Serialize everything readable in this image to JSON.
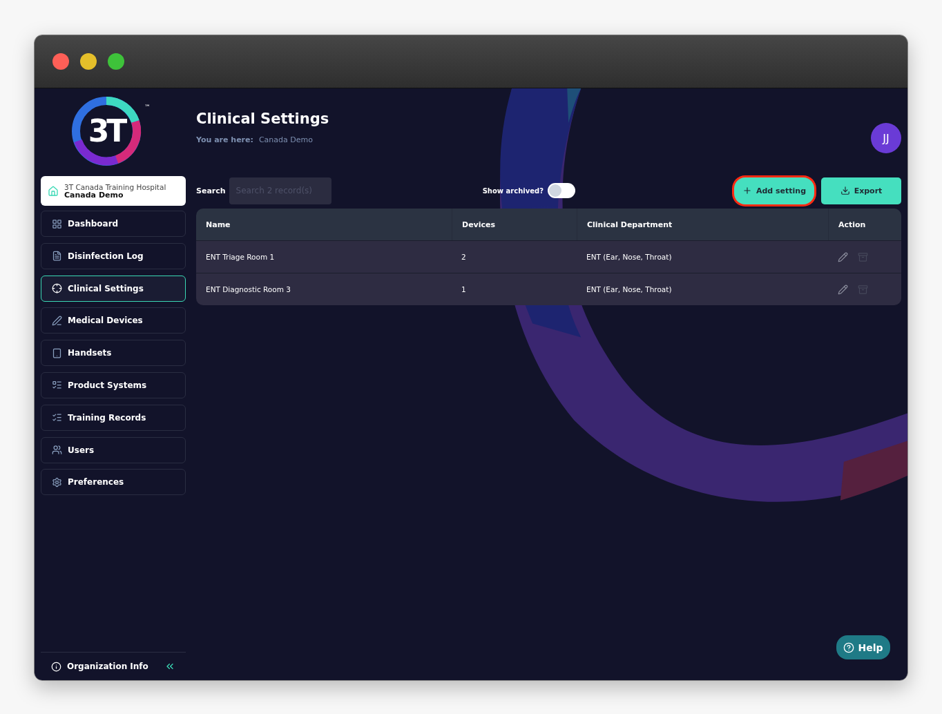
{
  "window": {
    "controls": [
      {
        "color": "#fe5f57"
      },
      {
        "color": "#e5bf2a"
      },
      {
        "color": "#3ec23a"
      }
    ]
  },
  "logo": {
    "text": "3T",
    "mark": "™"
  },
  "org": {
    "hospital": "3T Canada Training Hospital",
    "site": "Canada Demo"
  },
  "sidebar": {
    "items": [
      {
        "label": "Dashboard",
        "selected": false
      },
      {
        "label": "Disinfection Log",
        "selected": false
      },
      {
        "label": "Clinical Settings",
        "selected": true
      },
      {
        "label": "Medical Devices",
        "selected": false
      },
      {
        "label": "Handsets",
        "selected": false
      },
      {
        "label": "Product Systems",
        "selected": false
      },
      {
        "label": "Training Records",
        "selected": false
      },
      {
        "label": "Users",
        "selected": false
      },
      {
        "label": "Preferences",
        "selected": false
      }
    ],
    "footer": {
      "label": "Organization Info"
    }
  },
  "header": {
    "title": "Clinical Settings",
    "breadcrumb_label": "You are here:",
    "breadcrumb": "Canada Demo",
    "avatar": "JJ"
  },
  "toolbar": {
    "search_label": "Search",
    "search_placeholder": "Search 2 record(s)",
    "archived_label": "Show archived?",
    "archived_on": false,
    "buttons": [
      {
        "label": "Add setting",
        "highlighted": true
      },
      {
        "label": "Export",
        "highlighted": false
      }
    ]
  },
  "table": {
    "columns": [
      "Name",
      "Devices",
      "Clinical Department",
      "Action"
    ],
    "rows": [
      {
        "name": "ENT Triage Room 1",
        "devices": "2",
        "department": "ENT (Ear, Nose, Throat)"
      },
      {
        "name": "ENT Diagnostic Room 3",
        "devices": "1",
        "department": "ENT (Ear, Nose, Throat)"
      }
    ]
  },
  "help": {
    "label": "Help"
  }
}
